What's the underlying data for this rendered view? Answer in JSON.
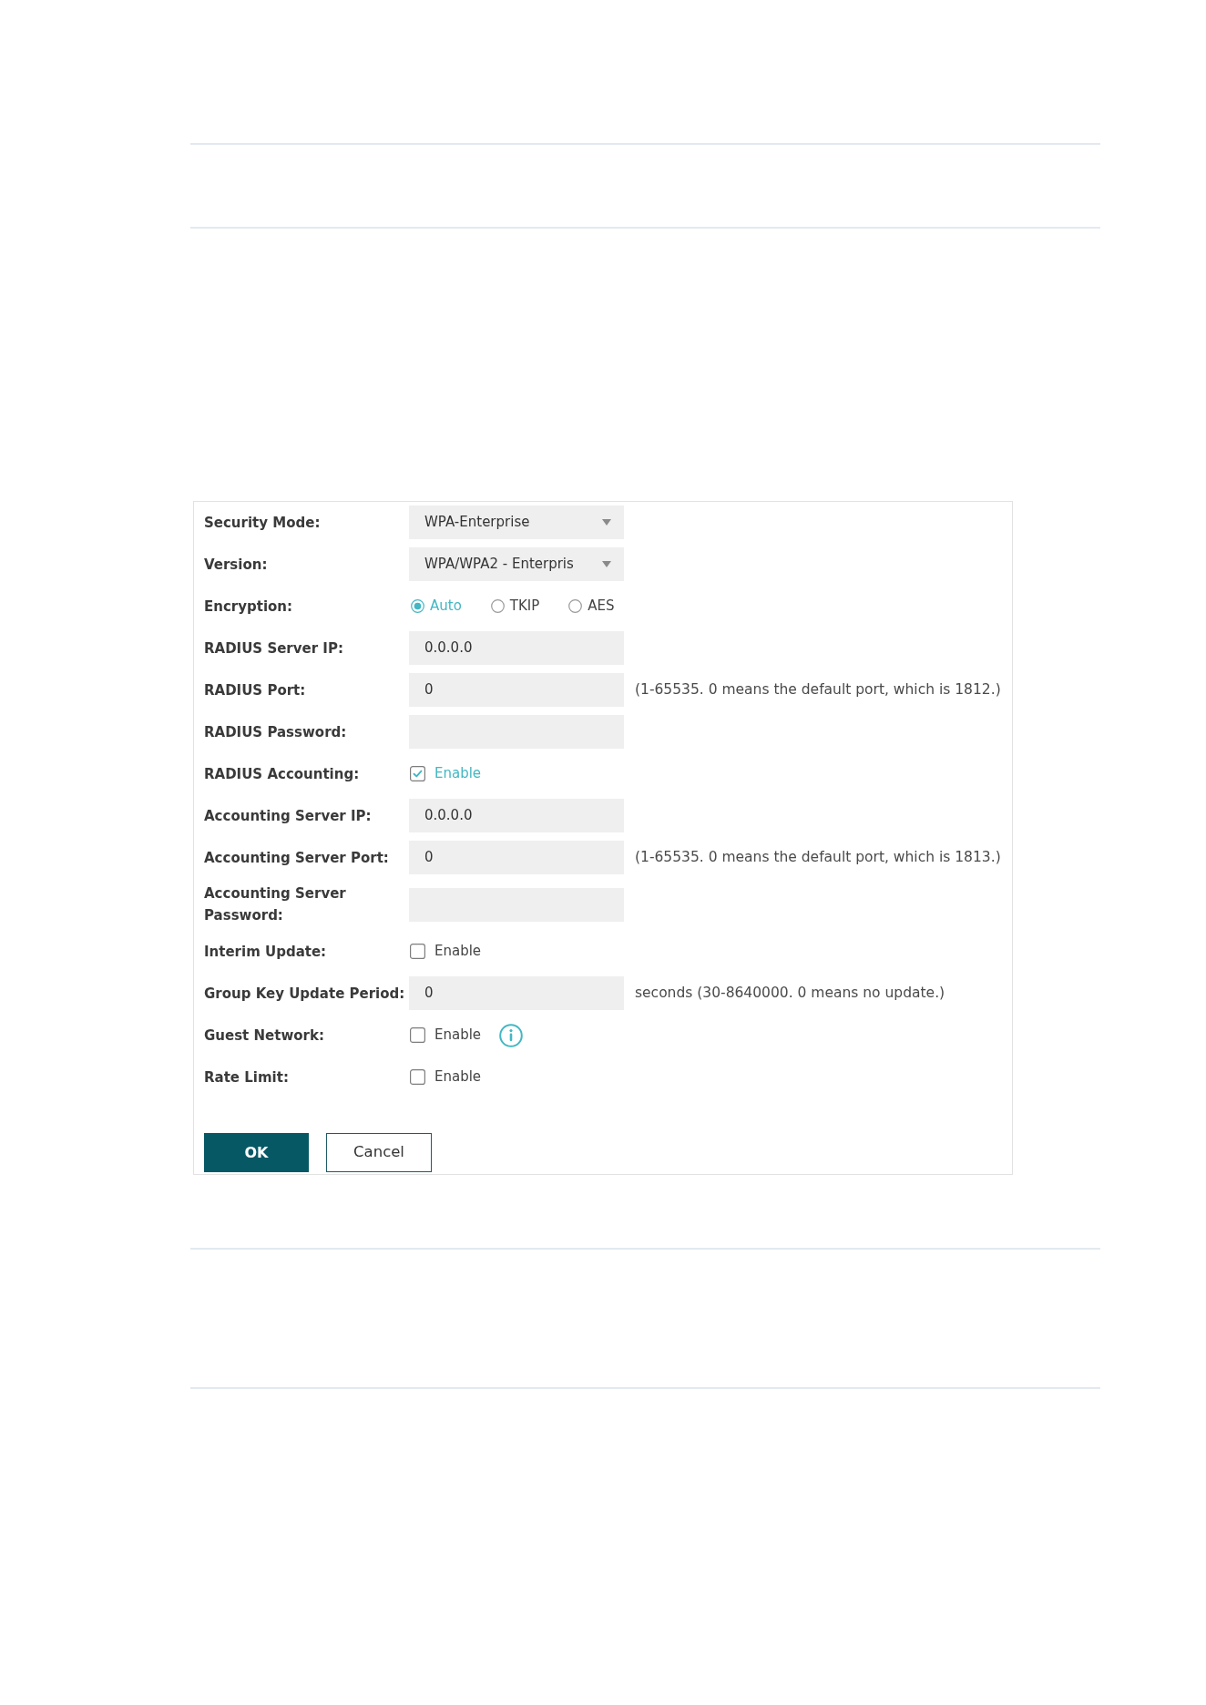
{
  "form": {
    "fields": [
      {
        "kind": "select",
        "label": "Security Mode:",
        "value": "WPA-Enterprise"
      },
      {
        "kind": "select",
        "label": "Version:",
        "value": "WPA/WPA2 - Enterpris"
      },
      {
        "kind": "radio",
        "label": "Encryption:",
        "options": [
          {
            "label": "Auto",
            "selected": true
          },
          {
            "label": "TKIP",
            "selected": false
          },
          {
            "label": "AES",
            "selected": false
          }
        ]
      },
      {
        "kind": "text",
        "label": "RADIUS Server IP:",
        "value": "0.0.0.0"
      },
      {
        "kind": "text",
        "label": "RADIUS Port:",
        "value": "0",
        "hint": "(1-65535. 0 means the default port, which is 1812.)"
      },
      {
        "kind": "text",
        "label": "RADIUS Password:"
      },
      {
        "kind": "checkbox",
        "label": "RADIUS Accounting:",
        "option": "Enable",
        "checked": true
      },
      {
        "kind": "text",
        "label": "Accounting Server IP:",
        "value": "0.0.0.0"
      },
      {
        "kind": "text",
        "label": "Accounting Server Port:",
        "value": "0",
        "hint": "(1-65535. 0 means the default port, which is 1813.)"
      },
      {
        "kind": "text",
        "label": "Accounting Server Password:"
      },
      {
        "kind": "checkbox",
        "label": "Interim Update:",
        "option": "Enable",
        "checked": false
      },
      {
        "kind": "text",
        "label": "Group Key Update Period:",
        "value": "0",
        "hint": "seconds (30-8640000. 0 means no update.)"
      },
      {
        "kind": "checkbox",
        "label": "Guest Network:",
        "option": "Enable",
        "checked": false,
        "info": true
      },
      {
        "kind": "checkbox",
        "label": "Rate Limit:",
        "option": "Enable",
        "checked": false
      }
    ],
    "buttons": [
      {
        "kind": "confirm",
        "label": "OK"
      },
      {
        "kind": "cancel",
        "label": "Cancel"
      }
    ]
  }
}
